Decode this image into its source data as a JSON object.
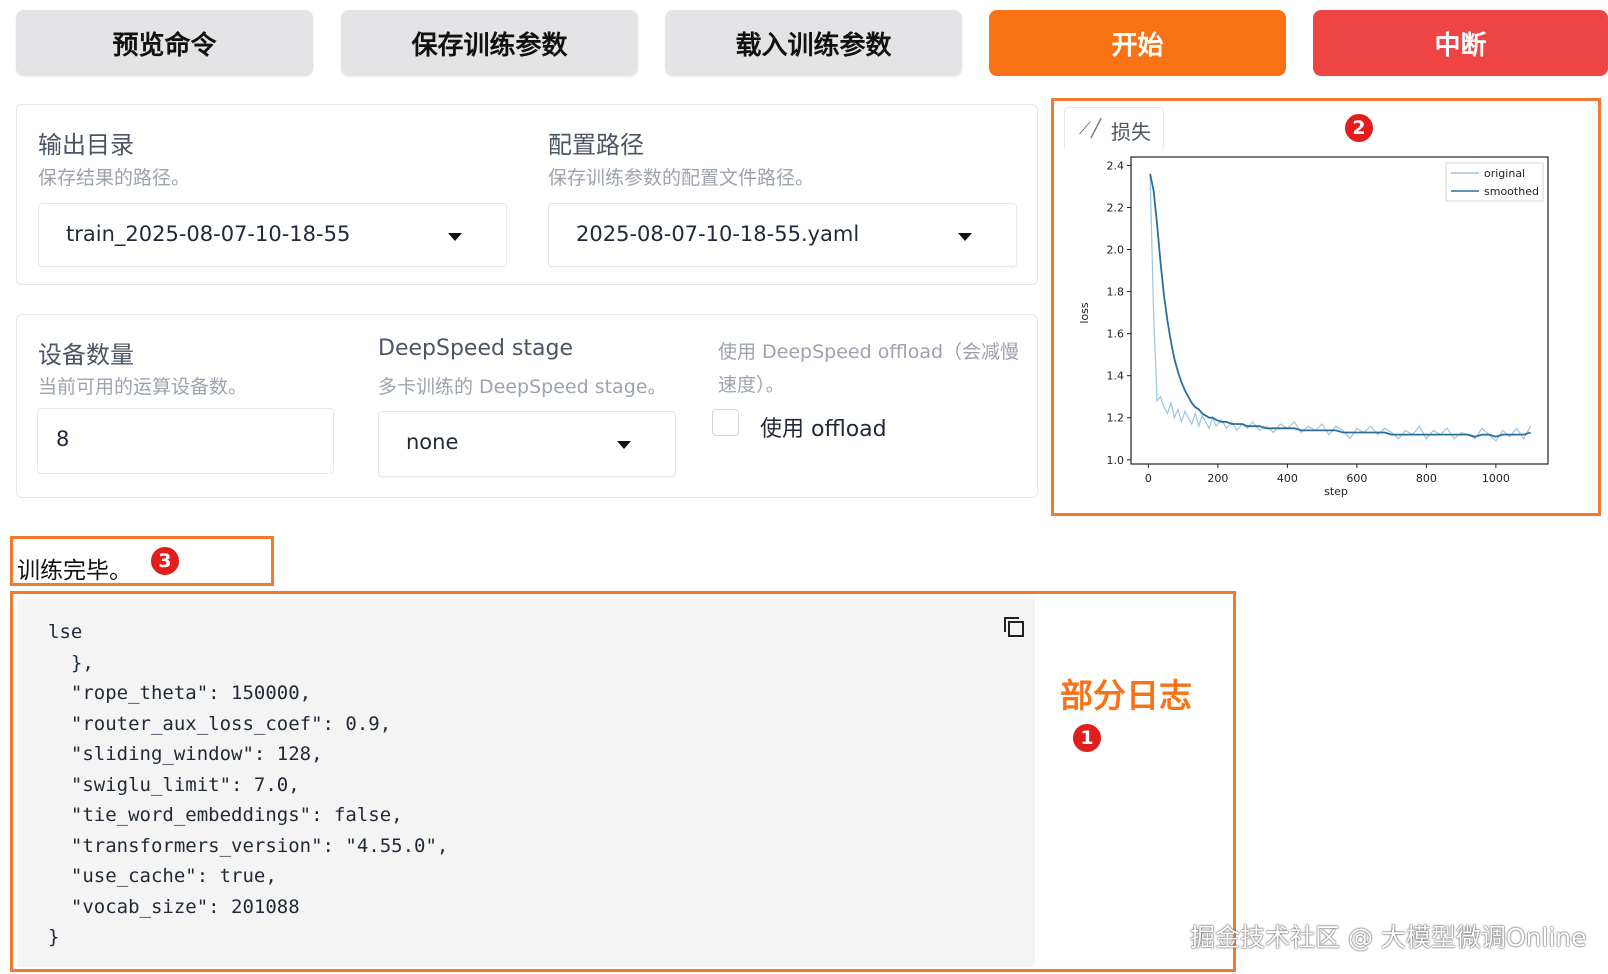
{
  "toolbar": {
    "preview_label": "预览命令",
    "save_label": "保存训练参数",
    "load_label": "载入训练参数",
    "start_label": "开始",
    "abort_label": "中断"
  },
  "output_dir": {
    "label": "输出目录",
    "hint": "保存结果的路径。",
    "value": "train_2025-08-07-10-18-55"
  },
  "config_path": {
    "label": "配置路径",
    "hint": "保存训练参数的配置文件路径。",
    "value": "2025-08-07-10-18-55.yaml"
  },
  "device_count": {
    "label": "设备数量",
    "hint": "当前可用的运算设备数。",
    "value": "8"
  },
  "ds_stage": {
    "label": "DeepSpeed stage",
    "hint": "多卡训练的 DeepSpeed stage。",
    "value": "none"
  },
  "ds_offload": {
    "hint_line1": "使用 DeepSpeed offload（会减慢",
    "hint_line2": "速度）。",
    "label": "使用 offload",
    "checked": false
  },
  "loss_panel": {
    "tab_label": "损失",
    "tab_icon": "chart-icon"
  },
  "chart_data": {
    "type": "line",
    "xlabel": "step",
    "ylabel": "loss",
    "xlim": [
      -50,
      1150
    ],
    "ylim": [
      0.98,
      2.44
    ],
    "xticks": [
      "0",
      "200",
      "400",
      "600",
      "800",
      "1000"
    ],
    "yticks": [
      "1.0",
      "1.2",
      "1.4",
      "1.6",
      "1.8",
      "2.0",
      "2.2",
      "2.4"
    ],
    "legend_position": "top-right",
    "series": [
      {
        "name": "original",
        "color": "#9ec5e0",
        "x": [
          5,
          15,
          25,
          35,
          45,
          55,
          65,
          75,
          85,
          95,
          105,
          115,
          125,
          135,
          145,
          155,
          165,
          175,
          185,
          195,
          210,
          225,
          240,
          255,
          270,
          285,
          300,
          320,
          340,
          360,
          380,
          400,
          420,
          440,
          460,
          480,
          500,
          520,
          540,
          560,
          580,
          600,
          620,
          640,
          660,
          680,
          700,
          720,
          740,
          760,
          780,
          800,
          820,
          840,
          860,
          880,
          900,
          920,
          940,
          960,
          980,
          1000,
          1020,
          1040,
          1060,
          1080,
          1100
        ],
        "y": [
          2.36,
          1.7,
          1.28,
          1.3,
          1.25,
          1.22,
          1.27,
          1.2,
          1.24,
          1.18,
          1.23,
          1.2,
          1.17,
          1.22,
          1.16,
          1.21,
          1.18,
          1.15,
          1.2,
          1.16,
          1.19,
          1.15,
          1.18,
          1.14,
          1.17,
          1.15,
          1.18,
          1.14,
          1.16,
          1.13,
          1.17,
          1.15,
          1.18,
          1.13,
          1.16,
          1.14,
          1.17,
          1.12,
          1.16,
          1.14,
          1.1,
          1.15,
          1.13,
          1.16,
          1.12,
          1.15,
          1.13,
          1.1,
          1.14,
          1.12,
          1.16,
          1.1,
          1.14,
          1.12,
          1.15,
          1.1,
          1.13,
          1.12,
          1.1,
          1.15,
          1.12,
          1.09,
          1.14,
          1.11,
          1.15,
          1.1,
          1.16
        ]
      },
      {
        "name": "smoothed",
        "color": "#2b6e9e",
        "x": [
          5,
          15,
          25,
          35,
          45,
          55,
          65,
          75,
          85,
          95,
          105,
          115,
          125,
          135,
          145,
          155,
          165,
          175,
          185,
          195,
          210,
          225,
          240,
          255,
          270,
          285,
          300,
          320,
          340,
          360,
          380,
          400,
          420,
          440,
          460,
          480,
          500,
          520,
          540,
          560,
          580,
          600,
          620,
          640,
          660,
          680,
          700,
          720,
          740,
          760,
          780,
          800,
          820,
          840,
          860,
          880,
          900,
          920,
          940,
          960,
          980,
          1000,
          1020,
          1040,
          1060,
          1080,
          1100
        ],
        "y": [
          2.36,
          2.28,
          2.12,
          1.94,
          1.78,
          1.66,
          1.56,
          1.48,
          1.42,
          1.37,
          1.33,
          1.3,
          1.27,
          1.25,
          1.24,
          1.22,
          1.21,
          1.2,
          1.2,
          1.19,
          1.18,
          1.18,
          1.17,
          1.17,
          1.17,
          1.16,
          1.16,
          1.16,
          1.15,
          1.15,
          1.15,
          1.15,
          1.15,
          1.14,
          1.14,
          1.14,
          1.14,
          1.14,
          1.14,
          1.13,
          1.13,
          1.13,
          1.13,
          1.13,
          1.13,
          1.13,
          1.12,
          1.12,
          1.12,
          1.12,
          1.12,
          1.12,
          1.12,
          1.12,
          1.12,
          1.12,
          1.12,
          1.12,
          1.11,
          1.12,
          1.12,
          1.11,
          1.12,
          1.12,
          1.12,
          1.12,
          1.13
        ]
      }
    ]
  },
  "status": {
    "message": "训练完毕。"
  },
  "log": {
    "lines": [
      "lse",
      "  },",
      "  \"rope_theta\": 150000,",
      "  \"router_aux_loss_coef\": 0.9,",
      "  \"sliding_window\": 128,",
      "  \"swiglu_limit\": 7.0,",
      "  \"tie_word_embeddings\": false,",
      "  \"transformers_version\": \"4.55.0\",",
      "  \"use_cache\": true,",
      "  \"vocab_size\": 201088",
      "}"
    ]
  },
  "annotations": {
    "log_title": "部分日志",
    "badge_1": "1",
    "badge_2": "2",
    "badge_3": "3",
    "accent_color": "#f07a2e",
    "badge_color": "#e11d1d"
  },
  "watermark": "掘金技术社区 @ 大模型微调Online"
}
